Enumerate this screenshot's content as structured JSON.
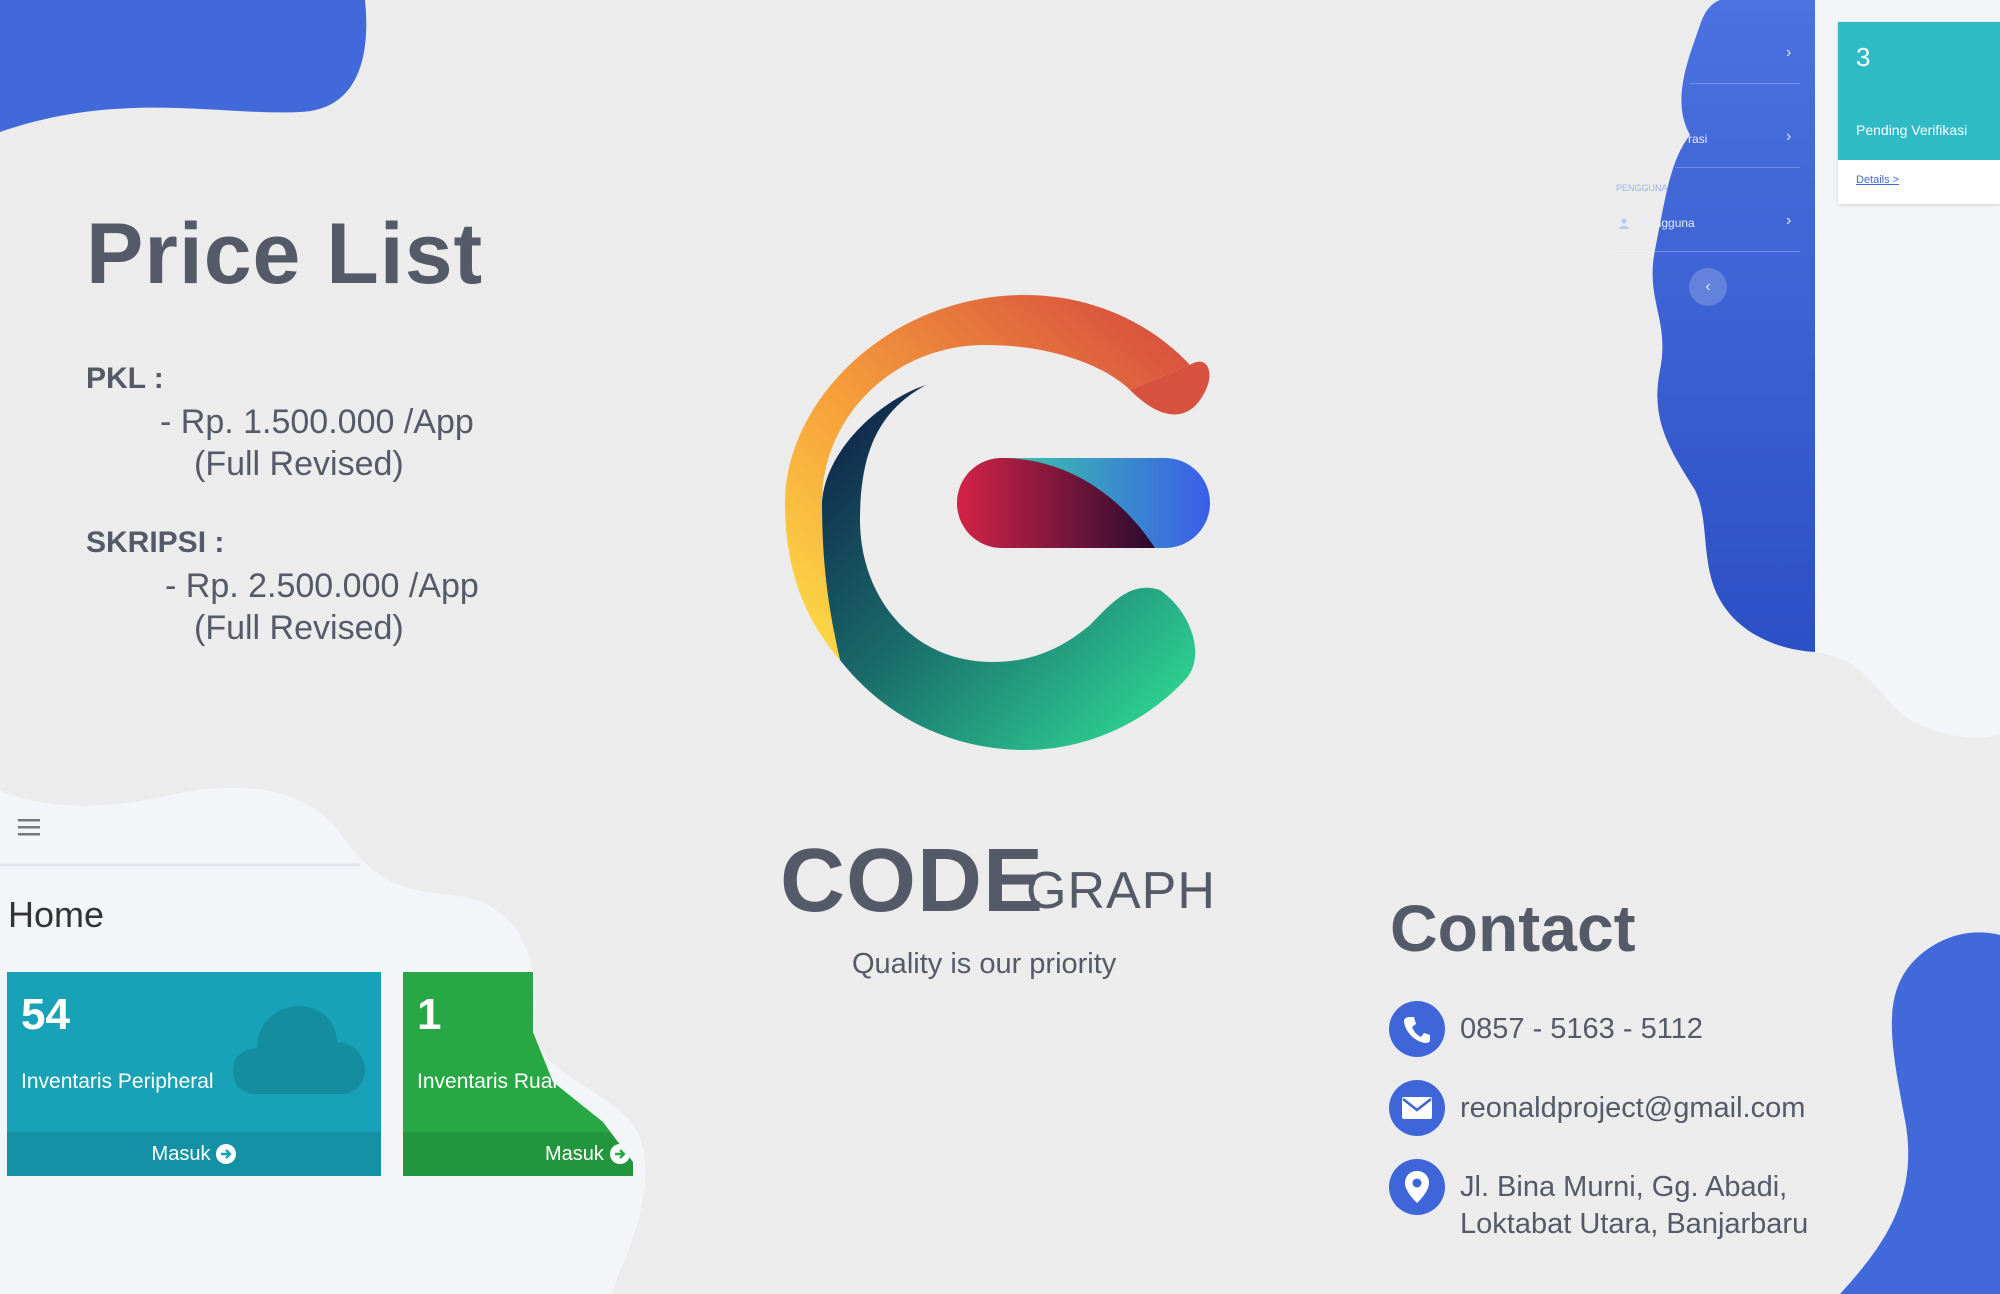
{
  "price": {
    "title": "Price List",
    "pkl": {
      "label": "PKL :",
      "line1": "-  Rp. 1.500.000 /App",
      "line2": "(Full Revised)"
    },
    "skripsi": {
      "label": "SKRIPSI :",
      "line1": "-  Rp. 2.500.000 /App",
      "line2": "(Full Revised)"
    }
  },
  "brand": {
    "code": "CODE",
    "graph": "GRAPH",
    "tagline": "Quality is our priority"
  },
  "contact": {
    "title": "Contact",
    "phone": "0857 - 5163 - 5112",
    "email": "reonaldproject@gmail.com",
    "address_line1": "Jl. Bina Murni, Gg. Abadi,",
    "address_line2": "Loktabat Utara, Banjarbaru",
    "icons": [
      "phone-icon",
      "mail-icon",
      "location-pin-icon"
    ],
    "accent": "#3f66d8"
  },
  "app_top": {
    "sidebar": {
      "item_registrasi": "Registrasi",
      "section_label": "PENGGUNA",
      "item_pengguna": "Pengguna"
    },
    "card": {
      "count": "3",
      "label": "Pending Verifikasi",
      "link": "Details >"
    }
  },
  "app_bottom": {
    "page_title": "Home",
    "cards": [
      {
        "count": "54",
        "label": "Inventaris Peripheral",
        "footer": "Masuk",
        "color": "#17a2b8"
      },
      {
        "count": "1",
        "label": "Inventaris Ruang",
        "footer": "Masuk",
        "color": "#28a745"
      }
    ]
  },
  "colors": {
    "blob": "#4169d9",
    "text": "#545a68",
    "background": "#ececec"
  }
}
